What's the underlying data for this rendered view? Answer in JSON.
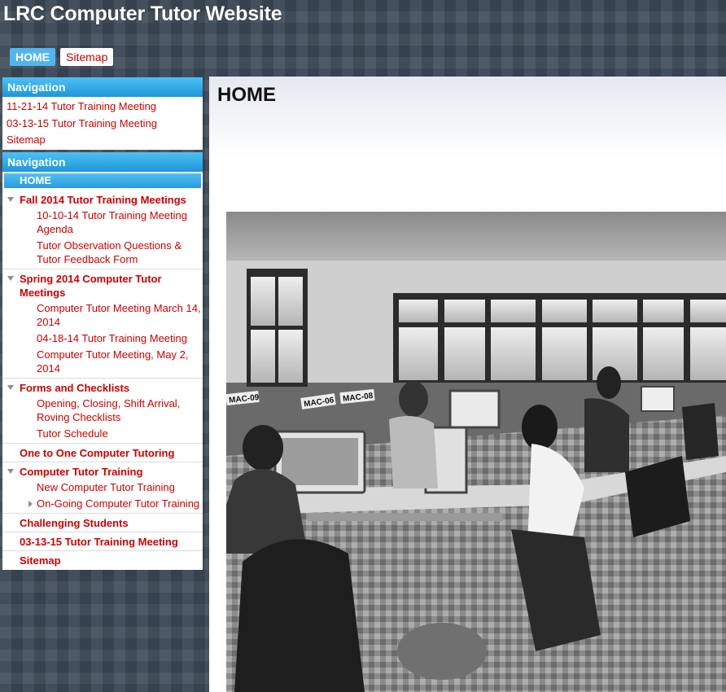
{
  "site": {
    "title": "LRC Computer Tutor Website"
  },
  "top_nav": {
    "home": "HOME",
    "sitemap": "Sitemap"
  },
  "sidebar_top": {
    "heading": "Navigation",
    "links": [
      "11-21-14 Tutor Training Meeting",
      "03-13-15 Tutor Training Meeting",
      "Sitemap"
    ]
  },
  "sidebar_tree": {
    "heading": "Navigation",
    "home": "HOME",
    "fall2014": {
      "title": "Fall 2014 Tutor Training Meetings",
      "items": [
        "10-10-14 Tutor Training Meeting Agenda",
        "Tutor Observation Questions & Tutor Feedback Form"
      ]
    },
    "spring2014": {
      "title": "Spring 2014 Computer Tutor Meetings",
      "items": [
        "Computer Tutor Meeting March 14, 2014",
        "04-18-14 Tutor Training Meeting",
        "Computer Tutor Meeting, May 2, 2014"
      ]
    },
    "forms": {
      "title": "Forms and Checklists",
      "items": [
        "Opening, Closing, Shift Arrival, Roving Checklists",
        "Tutor Schedule"
      ]
    },
    "one_to_one": "One to One Computer Tutoring",
    "training": {
      "title": "Computer Tutor Training",
      "items": [
        "New Computer Tutor Training",
        "On-Going Computer Tutor Training"
      ]
    },
    "challenging": "Challenging Students",
    "meeting_0313": "03-13-15 Tutor Training Meeting",
    "sitemap": "Sitemap"
  },
  "main": {
    "title": "HOME"
  },
  "photo": {
    "labels": [
      "MAC-09",
      "MAC-06",
      "MAC-08"
    ]
  },
  "colors": {
    "link": "#cc0000",
    "header_blue": "#1e95d9",
    "bg": "#3c4a57"
  }
}
